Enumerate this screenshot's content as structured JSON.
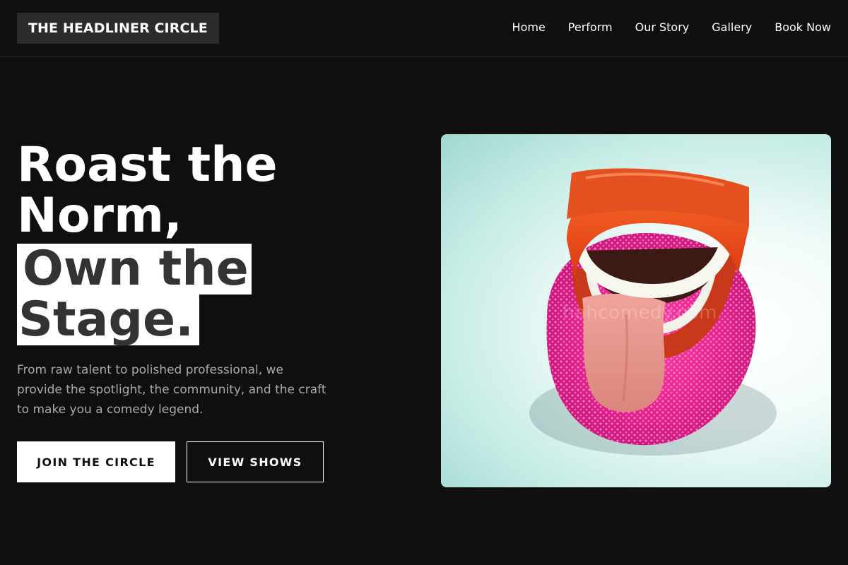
{
  "brand": {
    "name": "THE HEADLINER CIRCLE"
  },
  "nav": {
    "items": [
      {
        "label": "Home"
      },
      {
        "label": "Perform"
      },
      {
        "label": "Our Story"
      },
      {
        "label": "Gallery"
      },
      {
        "label": "Book Now"
      }
    ]
  },
  "hero": {
    "title_line_1": "Roast the",
    "title_line_2": "Norm,",
    "title_highlight_1": "Own the",
    "title_highlight_2": "Stage.",
    "description": "From raw talent to polished professional, we provide the spotlight, the community, and the craft to make you a comedy legend.",
    "primary_button": "JOIN THE CIRCLE",
    "secondary_button": "VIEW SHOWS",
    "image_watermark": "hahcomedy.com"
  },
  "colors": {
    "background": "#0f0f0f",
    "brand_box": "#2b2b2b",
    "highlight_bg": "#ffffff",
    "highlight_text": "#333333",
    "muted_text": "#a9a9a9"
  }
}
